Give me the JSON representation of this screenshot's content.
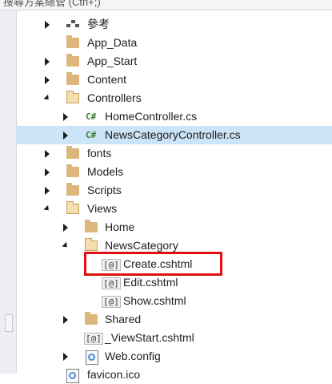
{
  "search": {
    "placeholder": "搜尋方案總管 (Ctrl+;)"
  },
  "tree": {
    "references": "參考",
    "app_data": "App_Data",
    "app_start": "App_Start",
    "content": "Content",
    "controllers": "Controllers",
    "home_controller": "HomeController.cs",
    "news_category_controller": "NewsCategoryController.cs",
    "fonts": "fonts",
    "models": "Models",
    "scripts": "Scripts",
    "views": "Views",
    "home": "Home",
    "news_category": "NewsCategory",
    "create": "Create.cshtml",
    "edit": "Edit.cshtml",
    "show": "Show.cshtml",
    "shared": "Shared",
    "viewstart": "_ViewStart.cshtml",
    "web_config": "Web.config",
    "favicon": "favicon.ico"
  },
  "icons": {
    "cs_glyph": "C#",
    "cshtml_glyph": "[@]"
  },
  "colors": {
    "selection": "#cce4f7",
    "highlight_box": "#e01010",
    "folder": "#dcb67a",
    "cs_icon": "#3a7d2e"
  }
}
